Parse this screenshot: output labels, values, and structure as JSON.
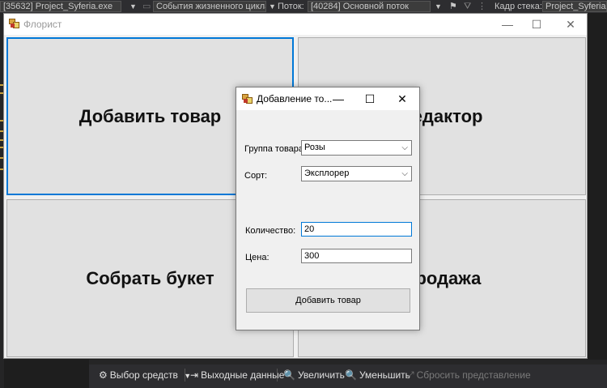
{
  "vs_toolbar": {
    "process": "[35632] Project_Syferia.exe",
    "lifecycle_events": "События жизненного цикла",
    "thread_label": "Поток:",
    "thread_value": "[40284] Основной поток",
    "stack_label": "Кадр стека:",
    "stack_value": "Project_Syferia.M"
  },
  "main_window": {
    "title": "Флорист",
    "buttons": {
      "add_product": "Добавить товар",
      "editor": "Редактор",
      "make_bouquet": "Собрать букет",
      "sale": "Продажа"
    }
  },
  "dialog": {
    "title": "Добавление то...",
    "group_label": "Группа товара:",
    "group_value": "Розы",
    "variety_label": "Сорт:",
    "variety_value": "Эксплорер",
    "quantity_label": "Количество:",
    "quantity_value": "20",
    "price_label": "Цена:",
    "price_value": "300",
    "add_button": "Добавить товар"
  },
  "vs_bottom": {
    "toolbox": "Выбор средств",
    "output": "Выходные данные",
    "zoom_in": "Увеличить",
    "zoom_out": "Уменьшить",
    "reset_view": "Сбросить представление"
  }
}
